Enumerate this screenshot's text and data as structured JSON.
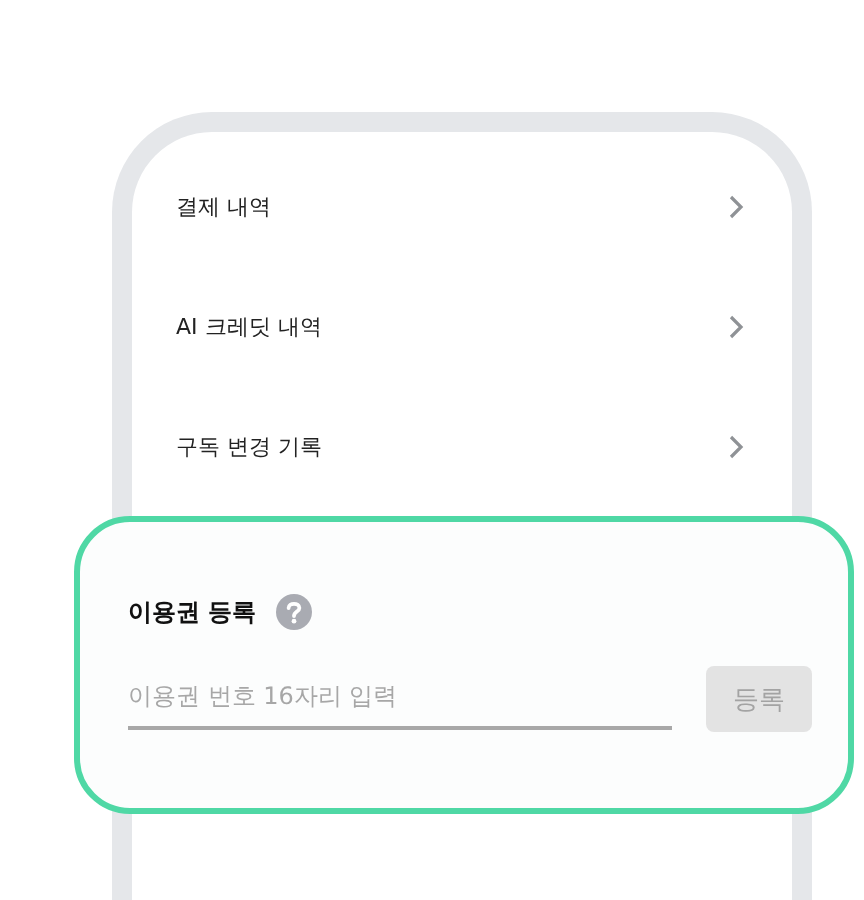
{
  "menu_items": [
    {
      "label": "결제 내역"
    },
    {
      "label": "AI 크레딧 내역"
    },
    {
      "label": "구독 변경 기록"
    }
  ],
  "voucher": {
    "title": "이용권 등록",
    "input": {
      "placeholder": "이용권 번호 16자리 입력"
    },
    "button": {
      "label": "등록",
      "disabled": true
    }
  }
}
